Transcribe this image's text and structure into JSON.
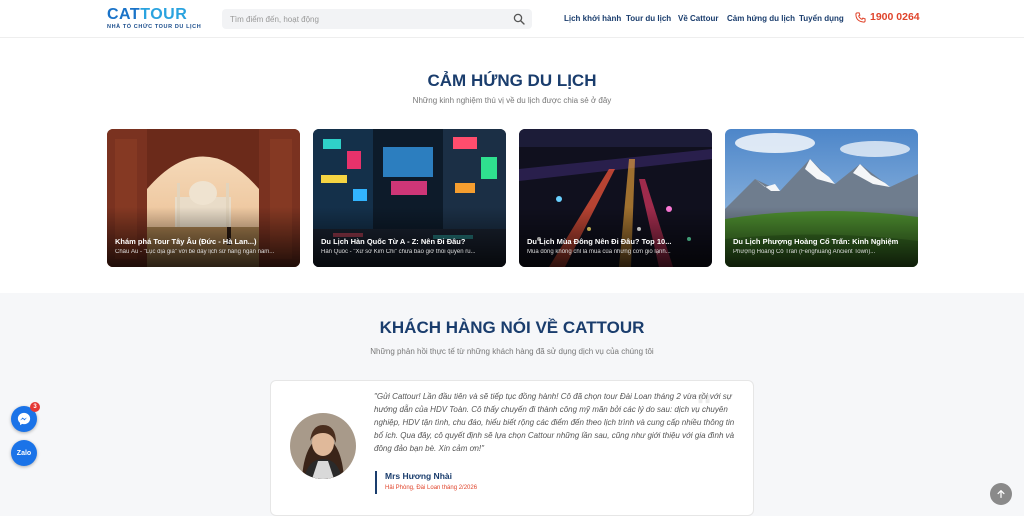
{
  "header": {
    "logo_text": "CATTOUR",
    "logo_tagline": "NHÀ TỔ CHỨC TOUR DU LỊCH",
    "search_placeholder": "Tìm điểm đến, hoạt động",
    "nav": [
      "Lịch khởi hành",
      "Tour du lịch",
      "Về Cattour",
      "Cảm hứng du lịch",
      "Tuyển dụng"
    ],
    "phone": "1900 0264",
    "phone_icon": "phone-icon",
    "search_icon": "search-icon"
  },
  "inspiration": {
    "title": "CẢM HỨNG DU LỊCH",
    "subtitle": "Những kinh nghiệm thú vị về du lịch được chia sẻ ở đây",
    "cards": [
      {
        "title": "Khám phá Tour Tây Âu (Đức - Hà Lan...)",
        "desc": "Châu Âu - \"Lục địa già\" với bề dày lịch sử hàng ngàn năm..."
      },
      {
        "title": "Du Lịch Hàn Quốc Từ A - Z: Nên Đi Đâu?",
        "desc": "Hàn Quốc - \"Xứ sở Kim Chi\" chưa bao giờ thôi quyến rũ..."
      },
      {
        "title": "Du Lịch Mùa Đông Nên Đi Đâu? Top 10...",
        "desc": "Mùa đông không chỉ là mùa của những cơn gió lạnh..."
      },
      {
        "title": "Du Lịch Phượng Hoàng Cổ Trấn: Kinh Nghiệm",
        "desc": "Phượng Hoàng Cổ Trấn (Fenghuang Ancient Town)..."
      }
    ]
  },
  "testimonials": {
    "title": "KHÁCH HÀNG NÓI VỀ CATTOUR",
    "subtitle": "Những phản hồi thực tế từ những khách hàng đã sử dụng dịch vụ của chúng tôi",
    "review": {
      "text": "\"Gửi Cattour! Lần đầu tiên và sẽ tiếp tục đồng hành! Cô đã chọn tour Đài Loan tháng 2 vừa rồi với sự hướng dẫn của HDV Toàn. Cô thấy chuyến đi thành công mỹ mãn bởi các lý do sau: dịch vụ chuyên nghiệp, HDV tận tình, chu đáo, hiểu biết rộng các điểm đến theo lịch trình và cung cấp nhiều thông tin bổ ích. Qua đây, cô quyết định sẽ lựa chọn Cattour những lần sau, cũng như giới thiệu với gia đình và đông đảo bạn bè. Xin cảm ơn!\"",
      "name": "Mrs Hương Nhài",
      "trip": "Hải Phòng, Đài Loan tháng 2/2026"
    }
  },
  "floating": {
    "messenger_badge": "3",
    "zalo_label": "Zalo"
  },
  "colors": {
    "brand": "#1a73c8",
    "heading": "#1a3d6d",
    "accent": "#e0442b"
  }
}
